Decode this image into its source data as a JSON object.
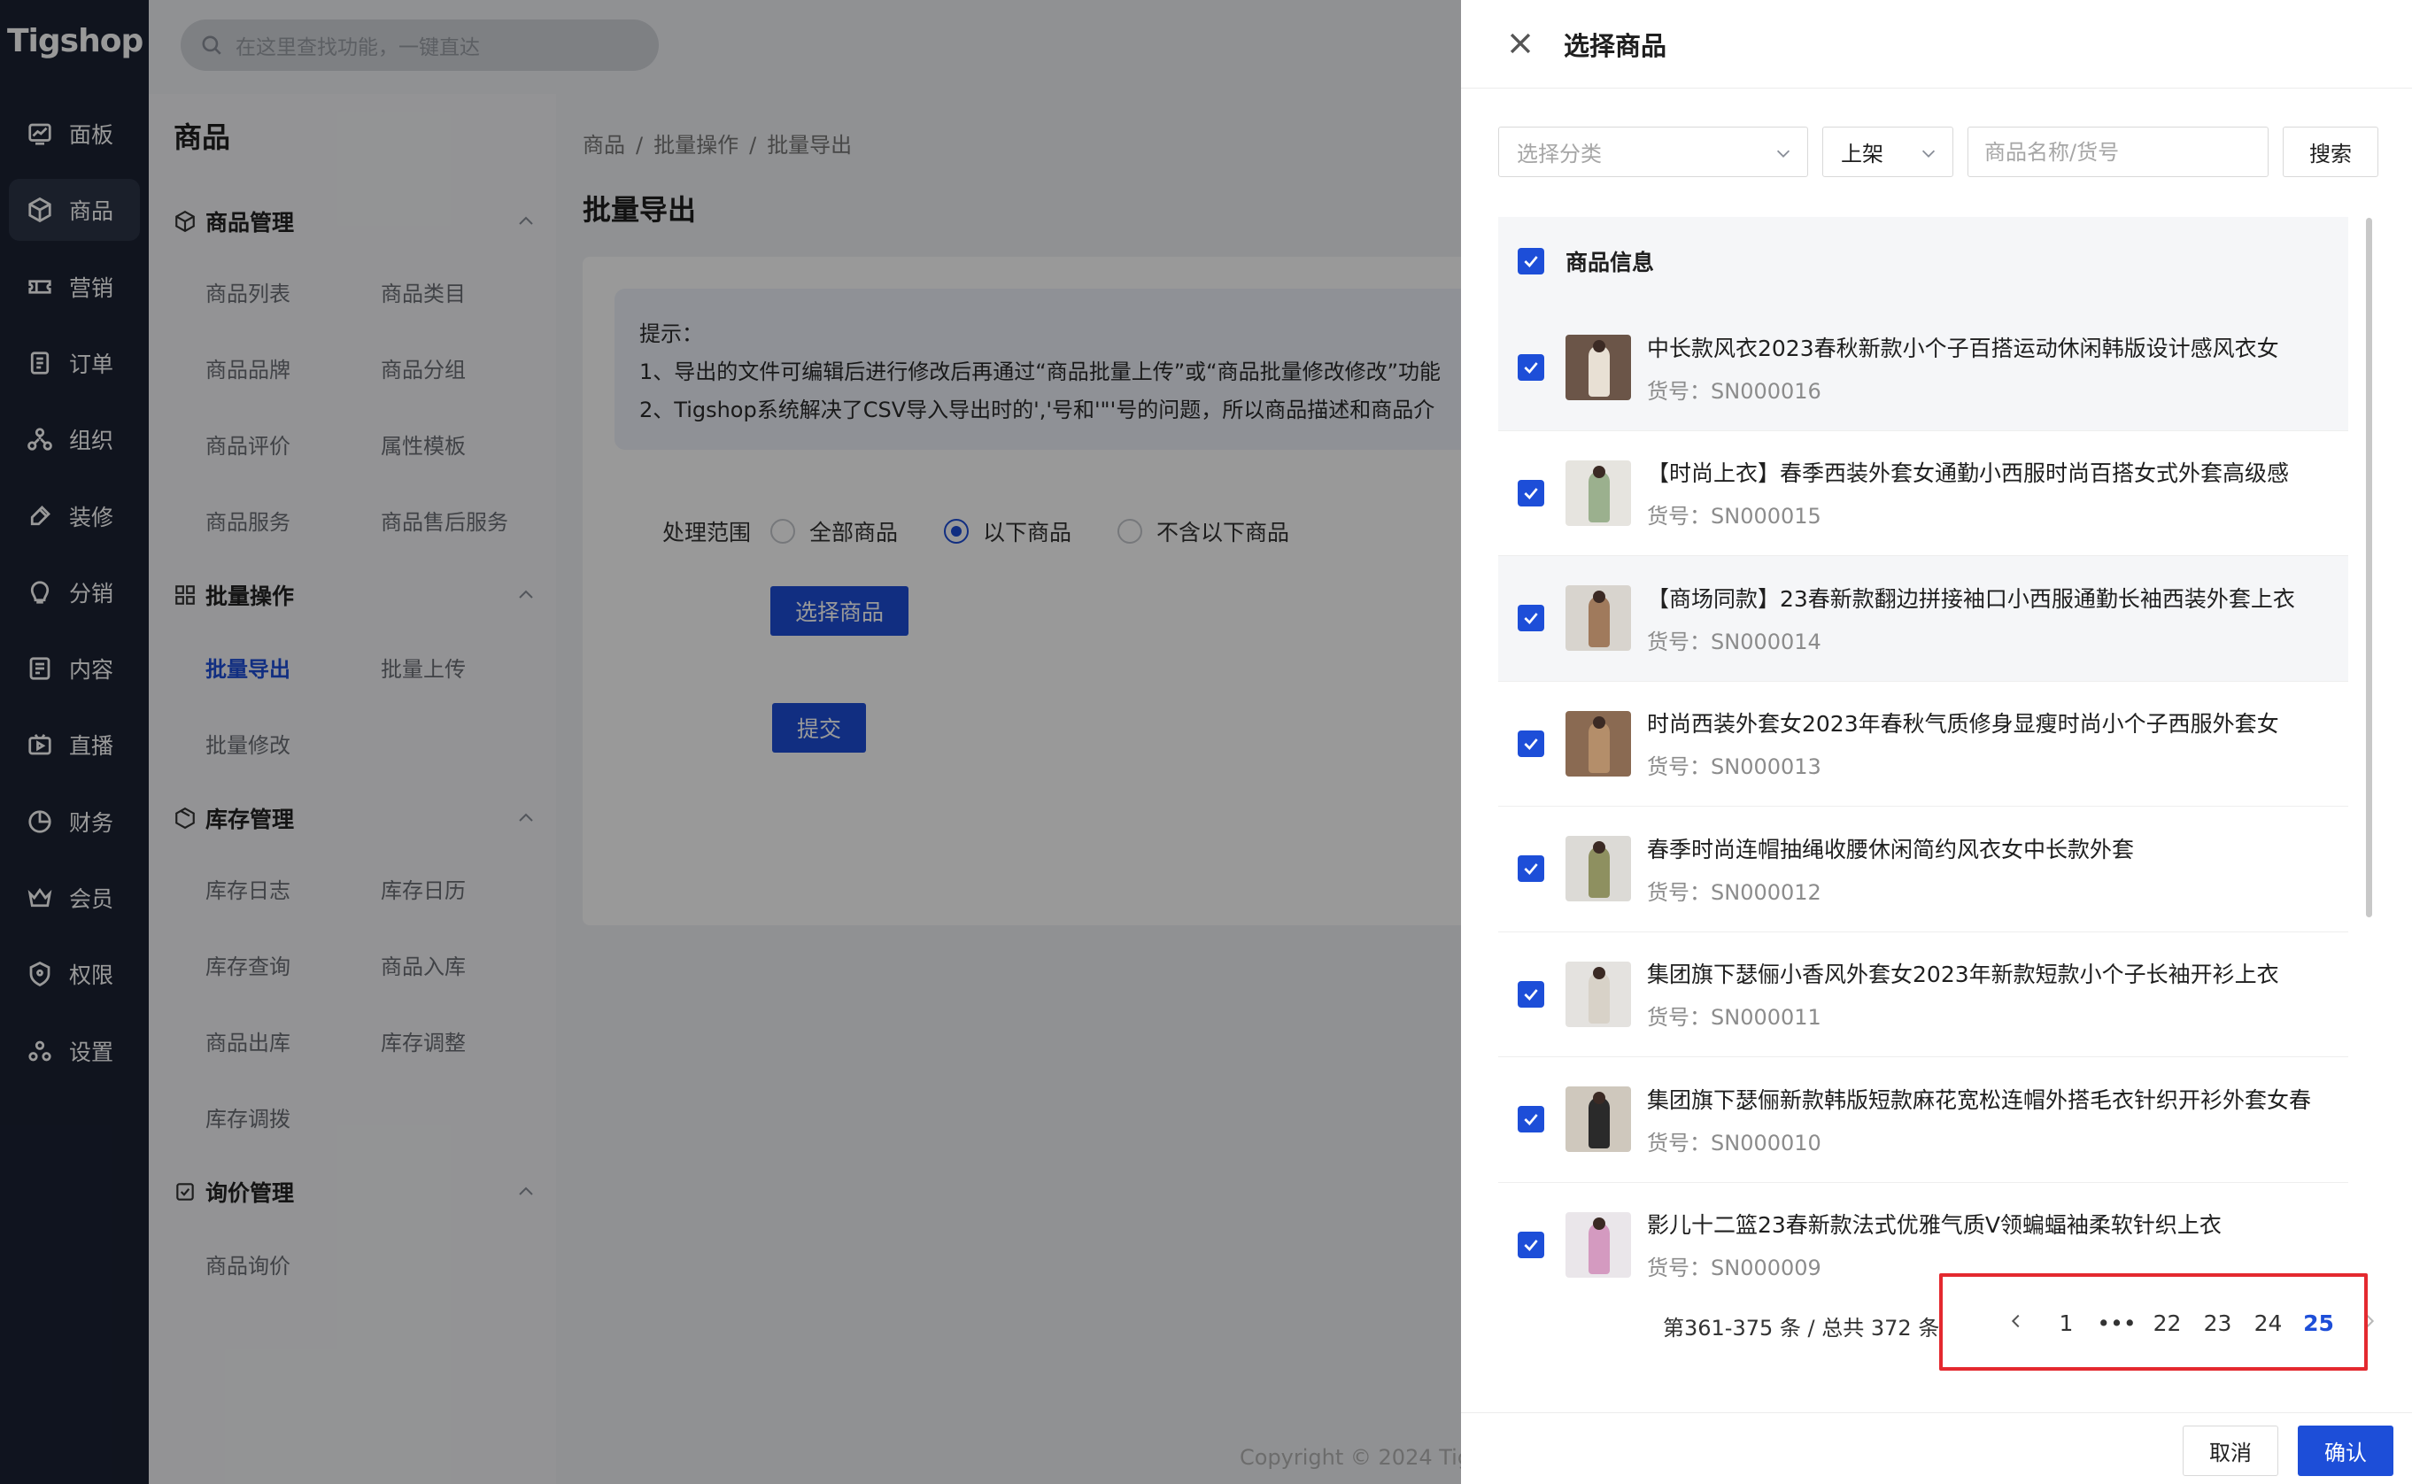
{
  "app": {
    "logo": "Tigshop"
  },
  "topbar": {
    "search_placeholder": "在这里查找功能，一键直达"
  },
  "nav": {
    "items": [
      {
        "label": "面板",
        "icon": "dashboard-icon"
      },
      {
        "label": "商品",
        "icon": "box-icon",
        "active": true
      },
      {
        "label": "营销",
        "icon": "ticket-icon"
      },
      {
        "label": "订单",
        "icon": "order-icon"
      },
      {
        "label": "组织",
        "icon": "org-icon"
      },
      {
        "label": "装修",
        "icon": "brush-icon"
      },
      {
        "label": "分销",
        "icon": "share-icon"
      },
      {
        "label": "内容",
        "icon": "content-icon"
      },
      {
        "label": "直播",
        "icon": "live-icon"
      },
      {
        "label": "财务",
        "icon": "finance-icon"
      },
      {
        "label": "会员",
        "icon": "crown-icon"
      },
      {
        "label": "权限",
        "icon": "shield-icon"
      },
      {
        "label": "设置",
        "icon": "settings-icon"
      }
    ]
  },
  "submenu": {
    "title": "商品",
    "groups": [
      {
        "label": "商品管理",
        "links": [
          "商品列表",
          "商品类目",
          "商品品牌",
          "商品分组",
          "商品评价",
          "属性模板",
          "商品服务",
          "商品售后服务"
        ]
      },
      {
        "label": "批量操作",
        "links": [
          "批量导出",
          "批量上传",
          "批量修改"
        ]
      },
      {
        "label": "库存管理",
        "links": [
          "库存日志",
          "库存日历",
          "库存查询",
          "商品入库",
          "商品出库",
          "库存调整",
          "库存调拨"
        ]
      },
      {
        "label": "询价管理",
        "links": [
          "商品询价"
        ]
      }
    ]
  },
  "breadcrumb": [
    "商品",
    "批量操作",
    "批量导出"
  ],
  "page": {
    "title": "批量导出",
    "tip": {
      "heading": "提示：",
      "line1": "1、导出的文件可编辑后进行修改后再通过“商品批量上传”或“商品批量修改修改”功能",
      "line2": "2、Tigshop系统解决了CSV导入导出时的','号和'\"'号的问题，所以商品描述和商品介"
    },
    "range_label": "处理范围",
    "options": [
      "全部商品",
      "以下商品",
      "不含以下商品"
    ],
    "select_button": "选择商品",
    "submit_button": "提交",
    "copyright": "Copyright © 2024 Tig"
  },
  "drawer": {
    "title": "选择商品",
    "category_placeholder": "选择分类",
    "status_value": "上架",
    "keyword_placeholder": "商品名称/货号",
    "search_button": "搜索",
    "header_label": "商品信息",
    "sn_prefix": "货号：",
    "products": [
      {
        "name": "中长款风衣2023春秋新款小个子百搭运动休闲韩版设计感风衣女",
        "sn": "SN000016",
        "color": "#e8e0d4",
        "bg": "#6b5548"
      },
      {
        "name": "【时尚上衣】春季西装外套女通勤小西服时尚百搭女式外套高级感",
        "sn": "SN000015",
        "color": "#9bb08e",
        "bg": "#e6e4df"
      },
      {
        "name": "【商场同款】23春新款翻边拼接袖口小西服通勤长袖西装外套上衣",
        "sn": "SN000014",
        "color": "#a07a5c",
        "bg": "#d8d4ce"
      },
      {
        "name": "时尚西装外套女2023年春秋气质修身显瘦时尚小个子西服外套女",
        "sn": "SN000013",
        "color": "#b48e6a",
        "bg": "#8a6a52"
      },
      {
        "name": "春季时尚连帽抽绳收腰休闲简约风衣女中长款外套",
        "sn": "SN000012",
        "color": "#8e9060",
        "bg": "#dcdad6"
      },
      {
        "name": "集团旗下瑟俪小香风外套女2023年新款短款小个子长袖开衫上衣",
        "sn": "SN000011",
        "color": "#d8d2c8",
        "bg": "#e4e2df"
      },
      {
        "name": "集团旗下瑟俪新款韩版短款麻花宽松连帽外搭毛衣针织开衫外套女春",
        "sn": "SN000010",
        "color": "#2a2a2a",
        "bg": "#cfc8bd"
      },
      {
        "name": "影儿十二篮23春新款法式优雅气质V领蝙蝠袖柔软针织上衣",
        "sn": "SN000009",
        "color": "#d49ac0",
        "bg": "#eae6ea"
      }
    ],
    "pagination": {
      "summary": "第361-375 条 / 总共 372 条",
      "pages": [
        "1",
        "•••",
        "22",
        "23",
        "24",
        "25"
      ],
      "current": "25"
    },
    "cancel_button": "取消",
    "confirm_button": "确认"
  }
}
